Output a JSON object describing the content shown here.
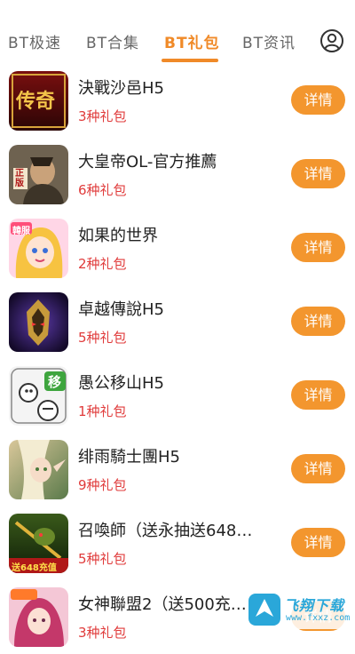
{
  "nav": {
    "tabs": [
      {
        "label": "BT极速"
      },
      {
        "label": "BT合集"
      },
      {
        "label": "BT礼包"
      },
      {
        "label": "BT资讯"
      }
    ],
    "active_index": 2,
    "user_icon": "user-circle-icon"
  },
  "colors": {
    "accent": "#f08a28",
    "button": "#f3962e",
    "gift_text": "#e03b3b"
  },
  "games": [
    {
      "title": "決戰沙邑H5",
      "gifts": "3种礼包",
      "button": "详情"
    },
    {
      "title": "大皇帝OL-官方推薦",
      "gifts": "6种礼包",
      "button": "详情"
    },
    {
      "title": "如果的世界",
      "gifts": "2种礼包",
      "button": "详情"
    },
    {
      "title": "卓越傳說H5",
      "gifts": "5种礼包",
      "button": "详情"
    },
    {
      "title": "愚公移山H5",
      "gifts": "1种礼包",
      "button": "详情"
    },
    {
      "title": "绯雨騎士團H5",
      "gifts": "9种礼包",
      "button": "详情"
    },
    {
      "title": "召喚師（送永抽送648…",
      "gifts": "5种礼包",
      "button": "详情"
    },
    {
      "title": "女神聯盟2（送500充…",
      "gifts": "3种礼包",
      "button": "详情"
    }
  ],
  "thumb_text": {
    "game0_logo": "传奇",
    "game1_badge": "正版",
    "game2_badge": "韓服",
    "game4_badge": "移",
    "game6_badge": "送648充值"
  },
  "watermark": {
    "text": "飞翔下载",
    "sub": "www.fxxz.com"
  }
}
